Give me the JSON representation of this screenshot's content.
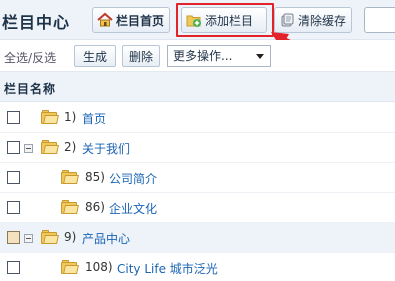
{
  "header": {
    "title": "栏目中心",
    "home_label": "栏目首页",
    "add_label": "添加栏目",
    "clear_label": "清除缓存"
  },
  "toolbar": {
    "select_all": "全选",
    "separator": "/",
    "invert": "反选",
    "generate_label": "生成",
    "delete_label": "删除",
    "more_ops": "更多操作..."
  },
  "table": {
    "column_title": "栏目名称",
    "rows": [
      {
        "id": "1)",
        "name": "首页"
      },
      {
        "id": "2)",
        "name": "关于我们"
      },
      {
        "id": "85)",
        "name": "公司简介"
      },
      {
        "id": "86)",
        "name": "企业文化"
      },
      {
        "id": "9)",
        "name": "产品中心"
      },
      {
        "id": "108)",
        "name": "City Life 城市泛光"
      }
    ]
  },
  "colors": {
    "highlight": "#e2232a",
    "link": "#1a64b4",
    "header_bg": "#eef3f9"
  },
  "icons": [
    "home-icon",
    "add-folder-icon",
    "clear-cache-icon",
    "folder-icon",
    "collapse-icon",
    "red-arrow"
  ]
}
